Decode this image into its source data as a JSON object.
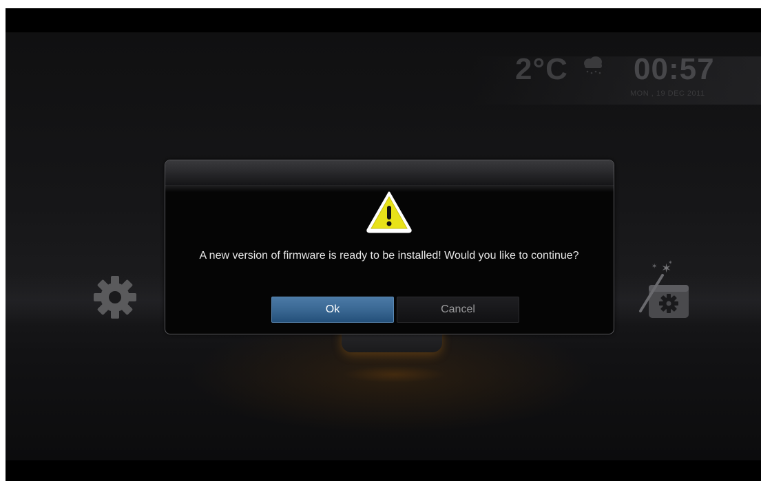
{
  "status_bar": {
    "temperature": "2°C",
    "weather_icon": "snow-cloud-icon",
    "time": "00:57",
    "date": "MON , 19 DEC 2011"
  },
  "home_menu": {
    "left_icon": "settings-gear-icon",
    "right_icon": "setup-wizard-icon"
  },
  "dialog": {
    "icon": "warning-icon",
    "message": "A new version of firmware is ready to be installed! Would you like to continue?",
    "buttons": {
      "ok_label": "Ok",
      "cancel_label": "Cancel"
    },
    "focused_button": "Ok"
  },
  "colors": {
    "ok_button": "#3a6893",
    "warning_yellow": "#e8e21a",
    "dialog_bg": "#050505"
  }
}
